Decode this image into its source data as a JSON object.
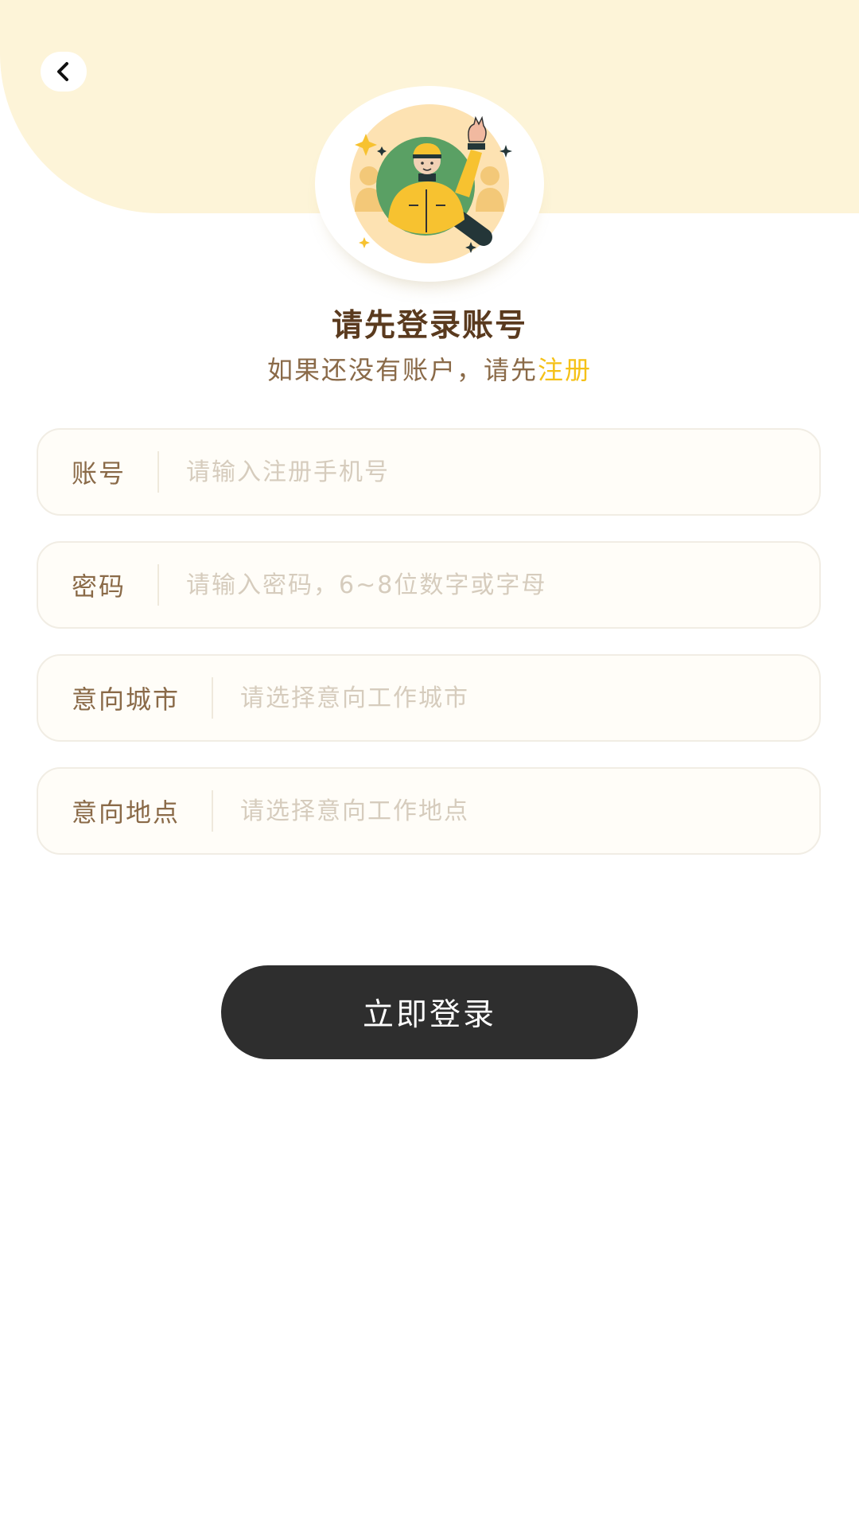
{
  "header": {
    "back_icon": "chevron-left-icon",
    "illustration_icon": "delivery-worker-magnifier-illustration"
  },
  "intro": {
    "title": "请先登录账号",
    "subtitle_prefix": "如果还没有账户，请先",
    "register_link": "注册"
  },
  "form": {
    "account": {
      "label": "账号",
      "placeholder": "请输入注册手机号",
      "value": ""
    },
    "password": {
      "label": "密码",
      "placeholder": "请输入密码，6~8位数字或字母",
      "value": ""
    },
    "city": {
      "label": "意向城市",
      "placeholder": "请选择意向工作城市",
      "value": ""
    },
    "location": {
      "label": "意向地点",
      "placeholder": "请选择意向工作地点",
      "value": ""
    }
  },
  "actions": {
    "login_label": "立即登录"
  },
  "colors": {
    "banner": "#fdf4d8",
    "accent": "#f5c118",
    "title": "#5a3a1e",
    "button": "#2e2e2e"
  }
}
